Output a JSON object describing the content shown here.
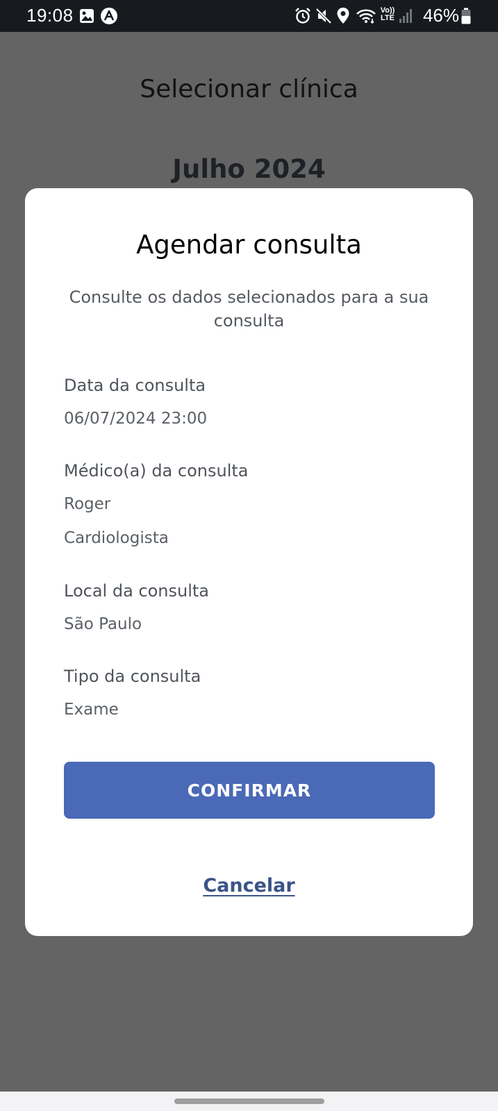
{
  "status_bar": {
    "time": "19:08",
    "battery_percent": "46%",
    "network_label_top": "Vo))",
    "network_label_bottom": "LTE",
    "icons": [
      "image-icon",
      "app-notification-icon",
      "alarm-icon",
      "mute-icon",
      "location-icon",
      "wifi-icon",
      "volte-icon",
      "signal-icon",
      "battery-icon"
    ]
  },
  "background": {
    "title": "Selecionar clínica",
    "month": "Julho 2024"
  },
  "modal": {
    "title": "Agendar consulta",
    "subtitle": "Consulte os dados selecionados para a sua consulta",
    "fields": {
      "date": {
        "label": "Data da consulta",
        "value": "06/07/2024 23:00"
      },
      "doctor": {
        "label": "Médico(a) da consulta",
        "name": "Roger",
        "specialty": "Cardiologista"
      },
      "location": {
        "label": "Local da consulta",
        "value": "São Paulo"
      },
      "type": {
        "label": "Tipo da consulta",
        "value": "Exame"
      }
    },
    "confirm_label": "CONFIRMAR",
    "cancel_label": "Cancelar"
  },
  "colors": {
    "overlay": "#646464",
    "modal_bg": "#ffffff",
    "primary_button": "#4a69b7",
    "cancel_link": "#3b5389",
    "status_bar": "#171b20"
  }
}
